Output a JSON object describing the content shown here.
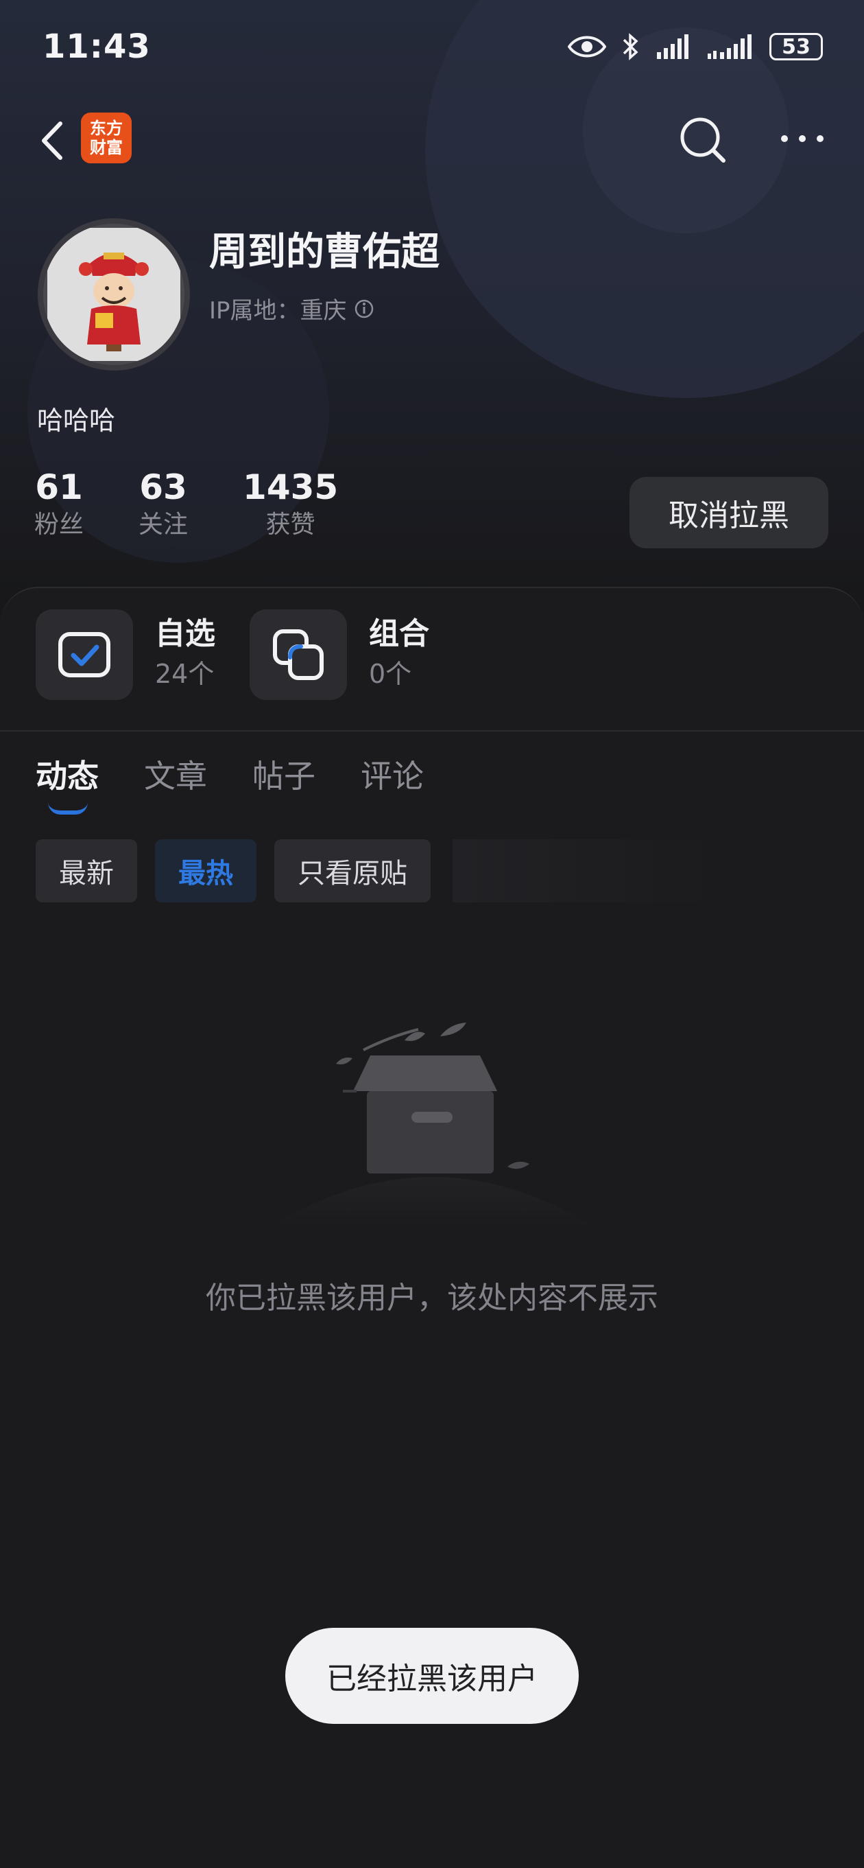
{
  "status_bar": {
    "time": "11:43",
    "battery": "53"
  },
  "nav": {
    "app_logo_line1": "东方",
    "app_logo_line2": "财富"
  },
  "profile": {
    "username": "周到的曹佑超",
    "ip_location": "IP属地：重庆",
    "bio": "哈哈哈",
    "stats": [
      {
        "value": "61",
        "label": "粉丝"
      },
      {
        "value": "63",
        "label": "关注"
      },
      {
        "value": "1435",
        "label": "获赞"
      }
    ],
    "unblock_label": "取消拉黑"
  },
  "widgets": {
    "watchlist": {
      "title": "自选",
      "count": "24个"
    },
    "portfolio": {
      "title": "组合",
      "count": "0个"
    }
  },
  "tabs": [
    {
      "label": "动态",
      "active": true
    },
    {
      "label": "文章",
      "active": false
    },
    {
      "label": "帖子",
      "active": false
    },
    {
      "label": "评论",
      "active": false
    }
  ],
  "filters": [
    {
      "label": "最新",
      "active": false
    },
    {
      "label": "最热",
      "active": true
    },
    {
      "label": "只看原贴",
      "active": false
    }
  ],
  "empty_message": "你已拉黑该用户，该处内容不展示",
  "toast": "已经拉黑该用户",
  "colors": {
    "accent": "#2f79e3",
    "background": "#18181a",
    "logo": "#e8501a"
  }
}
